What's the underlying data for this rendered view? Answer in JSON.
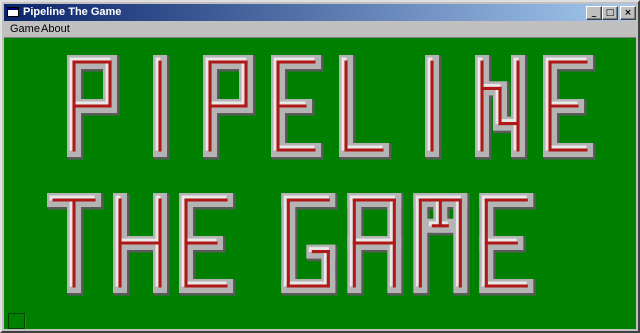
{
  "window": {
    "title": "Pipeline The Game",
    "buttons": {
      "minimize": "_",
      "maximize": "□",
      "close": "×"
    }
  },
  "menu": {
    "items": [
      "Game",
      "About"
    ]
  },
  "logo": {
    "line1": "PIPELINE",
    "line2": "THE GAME",
    "colors": {
      "background": "#008000",
      "pipe_body": "#b4b4b4",
      "pipe_core": "#b01818",
      "pipe_highlight": "#e8e8e8",
      "pipe_shadow": "#5a5a5a"
    }
  }
}
